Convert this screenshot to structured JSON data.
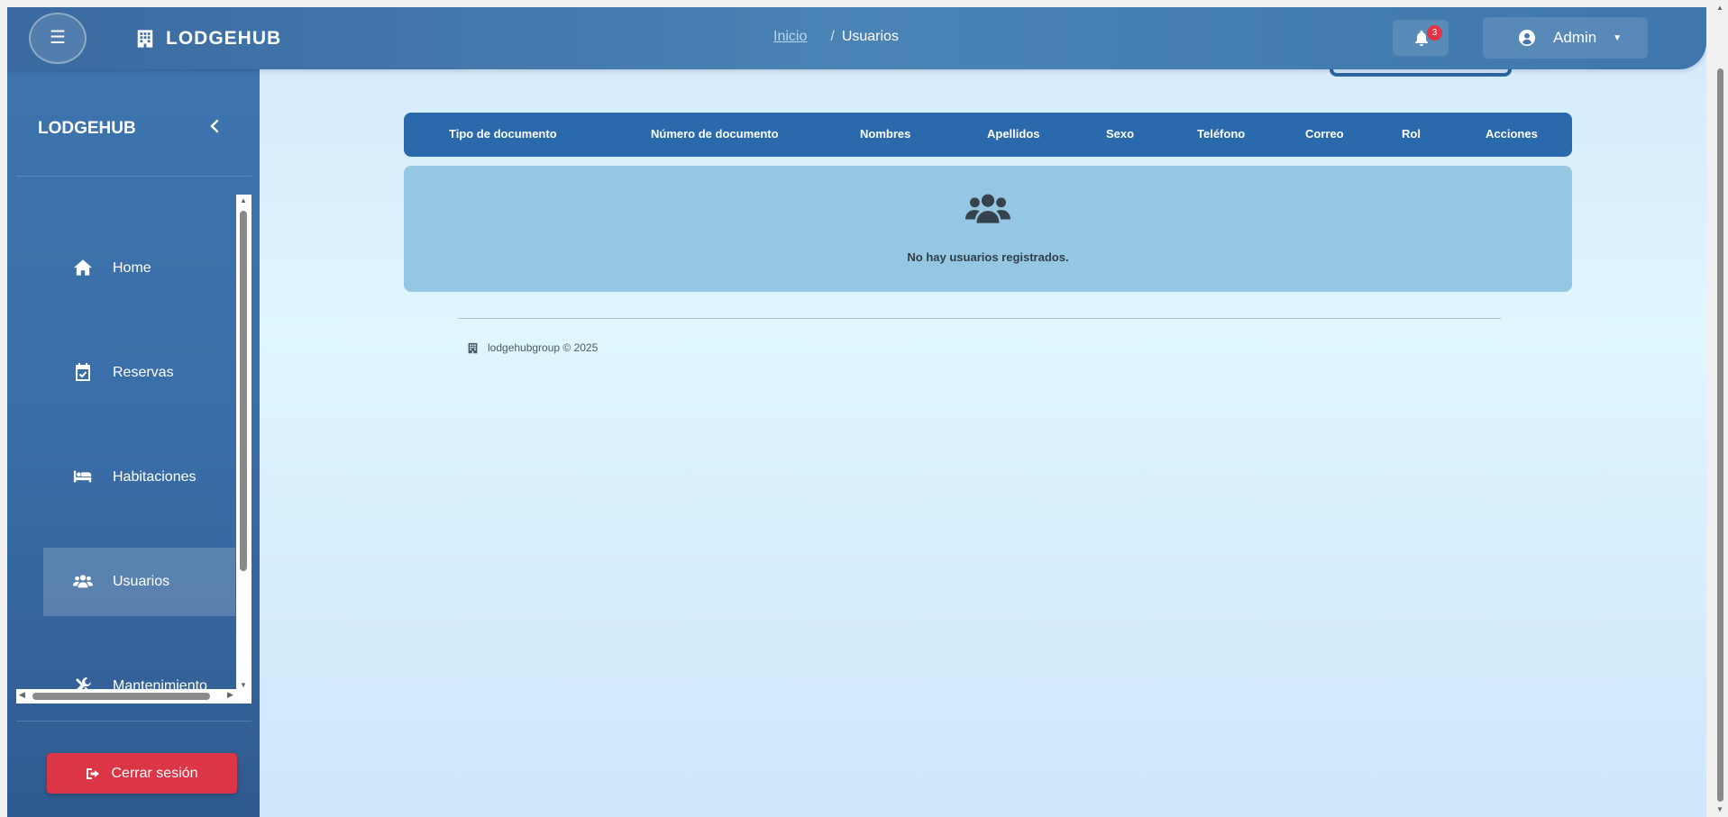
{
  "topbar": {
    "menu_icon": "hamburger-icon",
    "brand_icon": "building-icon",
    "brand_name": "LODGEHUB",
    "breadcrumb": {
      "home": "Inicio",
      "separator": "/",
      "current": "Usuarios"
    },
    "notifications": {
      "icon": "bell-icon",
      "count": "3"
    },
    "user": {
      "icon": "user-circle-icon",
      "name": "Admin",
      "caret_icon": "caret-down-icon"
    }
  },
  "sidebar": {
    "title": "LODGEHUB",
    "collapse_icon": "chevron-left-icon",
    "items": [
      {
        "label": "Home",
        "icon": "home-icon",
        "active": false
      },
      {
        "label": "Reservas",
        "icon": "calendar-check-icon",
        "active": false
      },
      {
        "label": "Habitaciones",
        "icon": "bed-icon",
        "active": false
      },
      {
        "label": "Usuarios",
        "icon": "users-icon",
        "active": true
      },
      {
        "label": "Mantenimiento",
        "icon": "tools-icon",
        "active": false
      }
    ],
    "logout": {
      "label": "Cerrar sesión",
      "icon": "sign-out-icon"
    }
  },
  "main": {
    "table": {
      "columns": [
        "Tipo de documento",
        "Número de documento",
        "Nombres",
        "Apellidos",
        "Sexo",
        "Teléfono",
        "Correo",
        "Rol",
        "Acciones"
      ],
      "rows": []
    },
    "empty_state": {
      "icon": "users-icon",
      "message": "No hay usuarios registrados."
    }
  },
  "footer": {
    "icon": "building-icon",
    "text": "lodgehubgroup © 2025"
  },
  "colors": {
    "topbar": "#3f77ad",
    "sidebar": "#3a6ea8",
    "table_header": "#2a69ac",
    "empty_box": "#95c7e3",
    "logout": "#dc3545",
    "badge": "#e03545"
  }
}
